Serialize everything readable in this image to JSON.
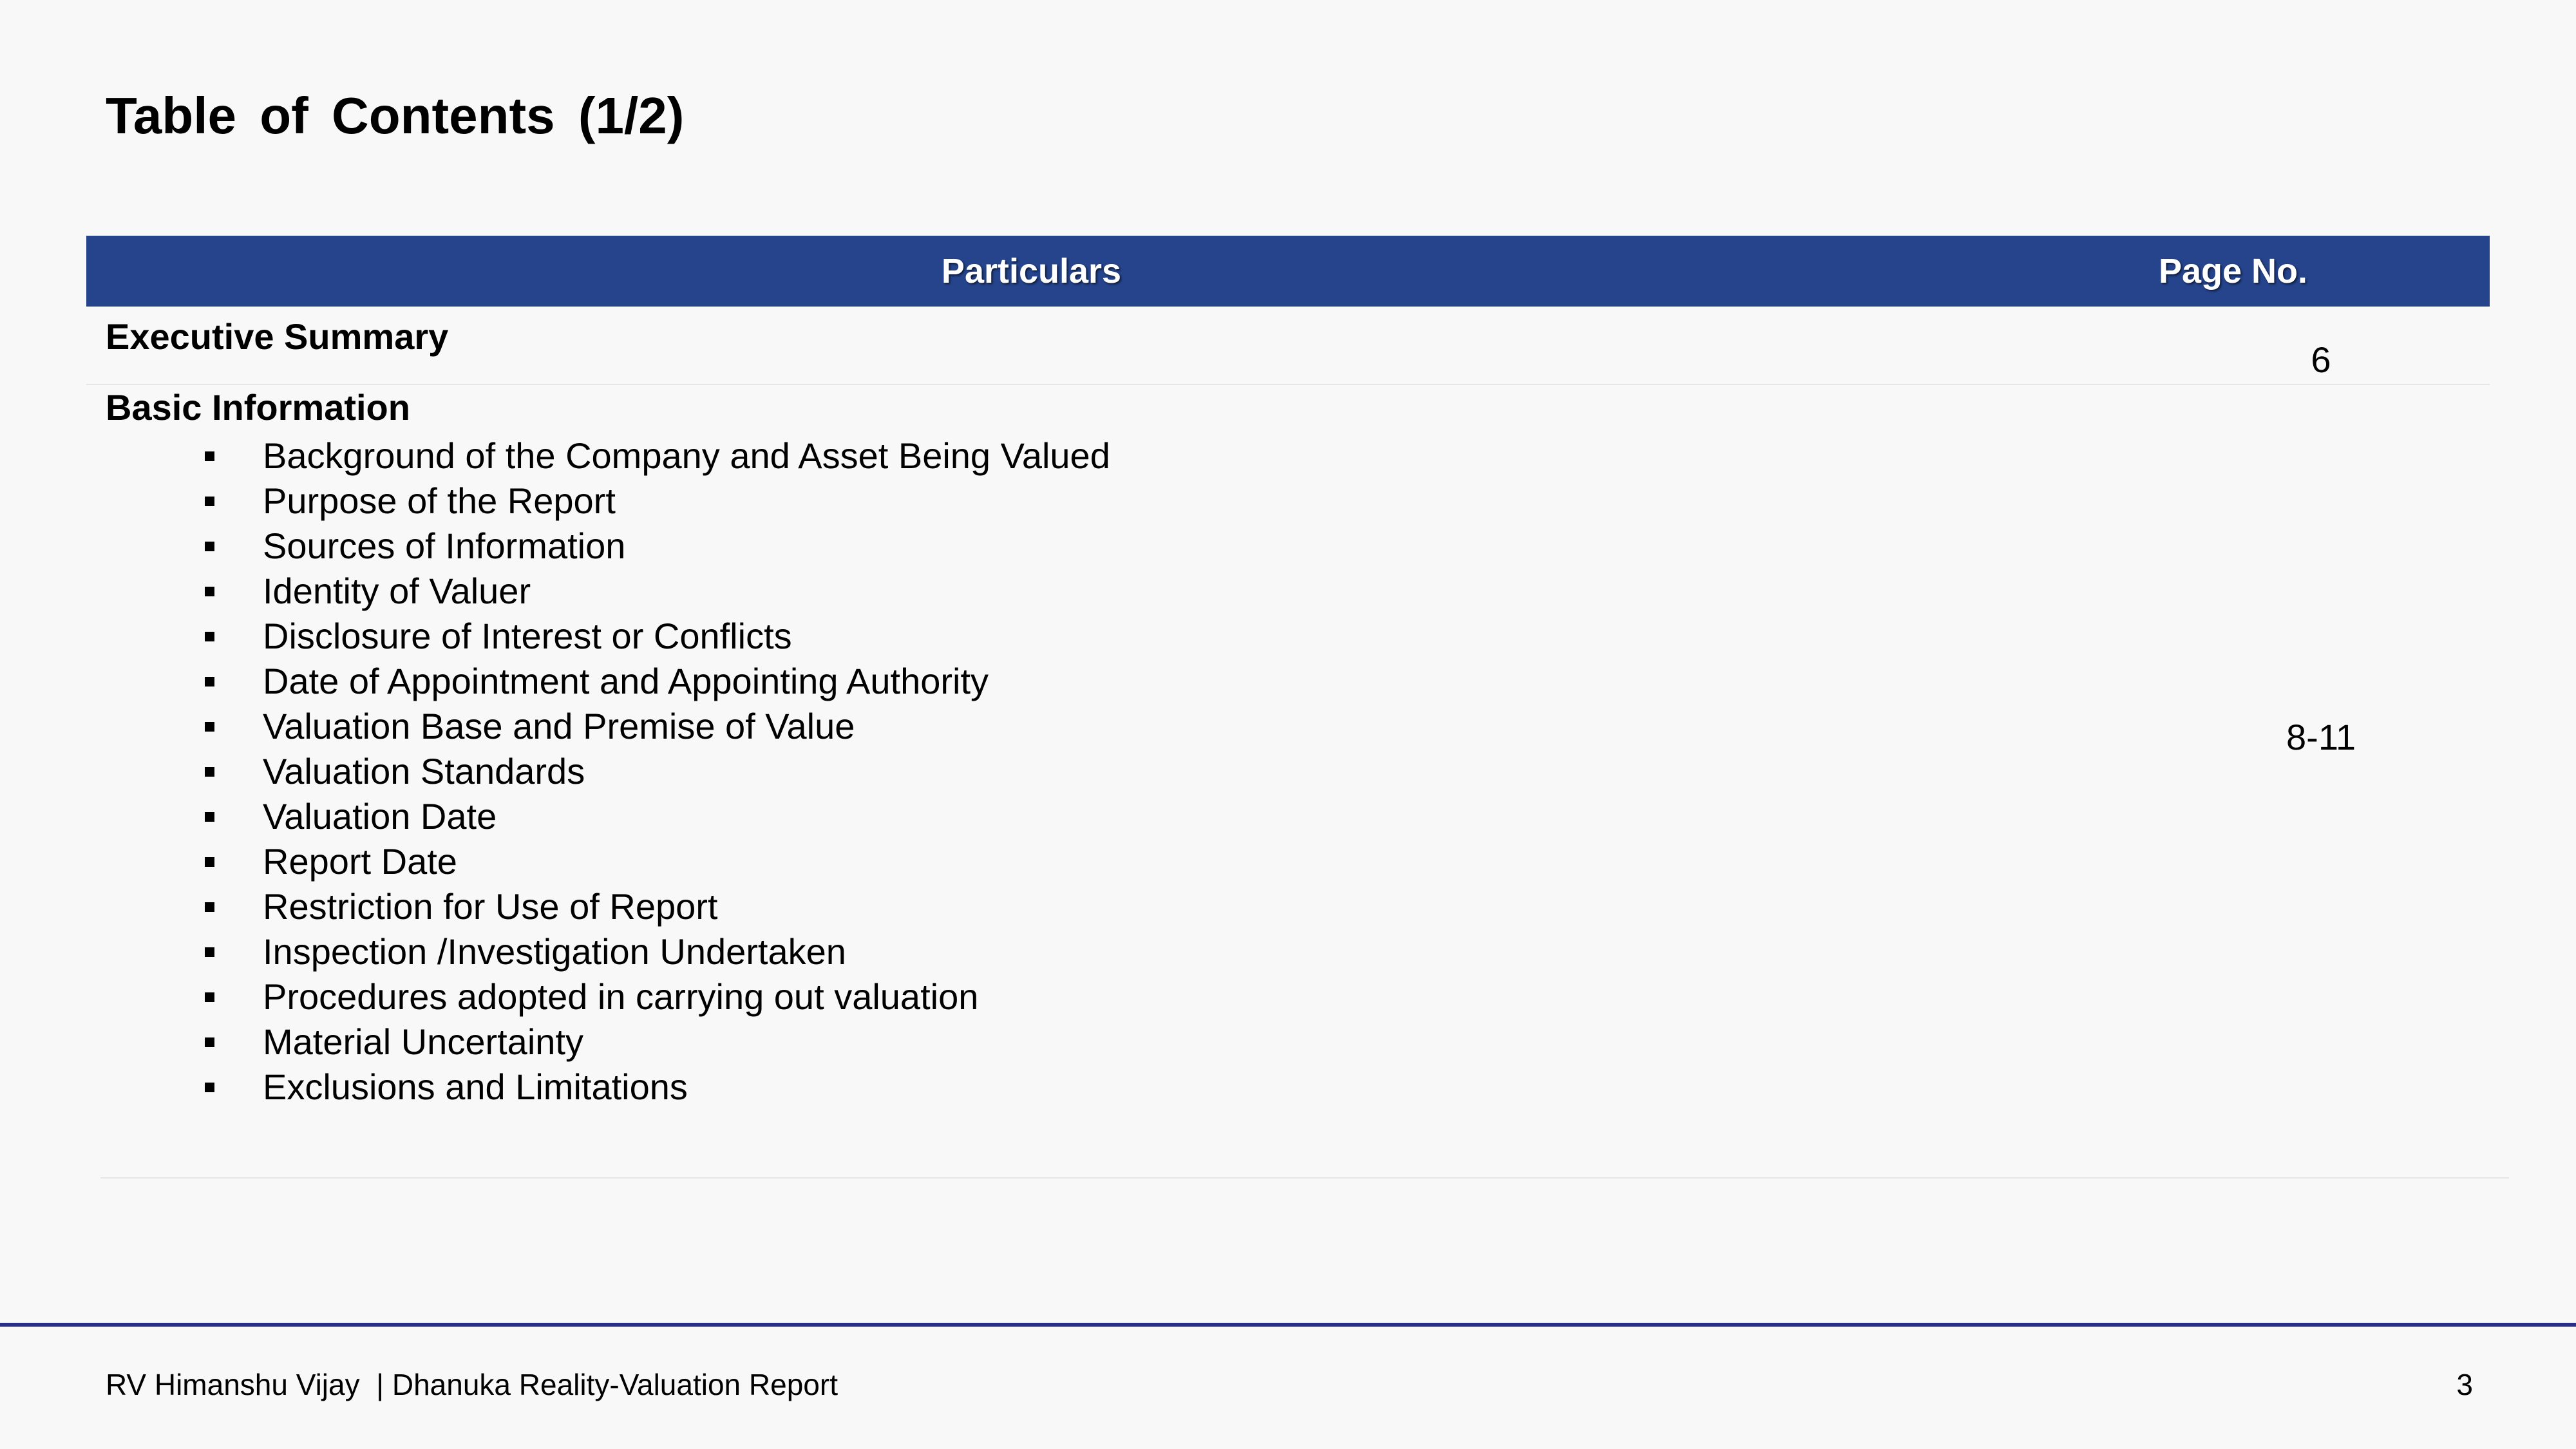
{
  "title": "Table of Contents  (1/2)",
  "table": {
    "headers": {
      "particulars": "Particulars",
      "page_no": "Page No."
    },
    "rows": [
      {
        "heading": "Executive Summary",
        "page": "6",
        "items": []
      },
      {
        "heading": "Basic Information",
        "page": "8-11",
        "items": [
          "Background of the Company and Asset Being Valued",
          "Purpose of the Report",
          "Sources of Information",
          "Identity of Valuer",
          "Disclosure of Interest or Conflicts",
          "Date of Appointment and Appointing Authority",
          "Valuation Base and Premise of Value",
          "Valuation Standards",
          "Valuation Date",
          "Report Date",
          "Restriction for Use of Report",
          "Inspection /Investigation Undertaken",
          "Procedures adopted in carrying out valuation",
          "Material Uncertainty",
          "Exclusions and Limitations"
        ]
      }
    ]
  },
  "footer": {
    "text": "RV Himanshu Vijay  | Dhanuka Reality-Valuation Report",
    "page_number": "3"
  },
  "colors": {
    "header_bg": "#26448b",
    "footer_rule": "#2b2e86",
    "background": "#f8f8f8"
  }
}
